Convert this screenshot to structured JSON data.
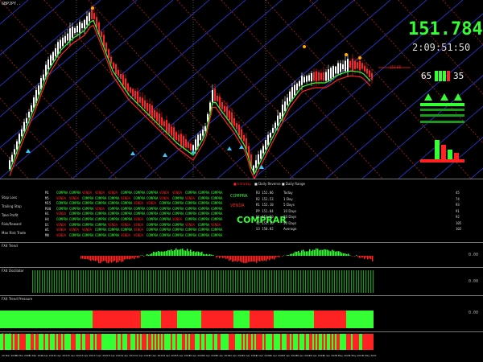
{
  "price": {
    "big": "151.784",
    "time": "2:09:51:50",
    "small_a": "65",
    "small_b": "35",
    "red_line_label": "151.66",
    "header": "GBPJPY.."
  },
  "tf_grid": {
    "row_labels": [
      "M1",
      "M5",
      "M15",
      "M30",
      "H1",
      "H4",
      "D1",
      "W1",
      "MN"
    ],
    "left_labels": [
      "Stop Loss",
      "Trailing Stop",
      "Take Profit",
      "Risk/Reward",
      "Max Risk Trade"
    ],
    "cell_text": "COMPRA",
    "cell_alt": "VENDA"
  },
  "signal": {
    "compra_label": "COMPRA",
    "compra_big": "COMPRAR",
    "venda_label": "VENDA",
    "intraday": "Intraday",
    "daily_reverse": "Daily Reverse",
    "daily_range": "Daily Range"
  },
  "levels": {
    "items": [
      {
        "code": "R3",
        "value": "152.86"
      },
      {
        "code": "R2",
        "value": "152.53"
      },
      {
        "code": "R1",
        "value": "152.18"
      },
      {
        "code": "PP",
        "value": "151.84"
      },
      {
        "code": "S1",
        "value": "151.50"
      },
      {
        "code": "S2",
        "value": "151.16"
      },
      {
        "code": "S3",
        "value": "150.82"
      }
    ]
  },
  "ranges": {
    "items": [
      {
        "label": "Today",
        "value": "45"
      },
      {
        "label": "1 Day",
        "value": "74"
      },
      {
        "label": "5 Days",
        "value": "93"
      },
      {
        "label": "10 Days",
        "value": "91"
      },
      {
        "label": "20 Days",
        "value": "92"
      },
      {
        "label": "50 Days",
        "value": "105"
      },
      {
        "label": "Average",
        "value": "102"
      }
    ]
  },
  "axis": {
    "x_labels": [
      "29 Mar 2021",
      "30 Mar 2021",
      "31 Mar 2021",
      "1 Apr 2021",
      "2 Apr 2021",
      "5 Apr 2021",
      "6 Apr 2021",
      "7 Apr 2021",
      "8 Apr 2021",
      "9 Apr 2021",
      "12 Apr 2021",
      "13 Apr 2021",
      "14 Apr 2021",
      "15 Apr 2021",
      "16 Apr 2021",
      "19 Apr 2021",
      "20 Apr 2021",
      "21 Apr 2021",
      "22 Apr 2021",
      "23 Apr 2021",
      "26 Apr 2021",
      "27 Apr 2021",
      "28 Apr 2021",
      "29 Apr 2021",
      "30 Apr 2021",
      "3 May 2021",
      "4 May 2021",
      "5 May 2021"
    ],
    "y_panel1": "0.00",
    "y_panel2": "0.00",
    "y_panel3": "0.00"
  },
  "panels": {
    "p1": "FX4 Trend",
    "p2": "FX4 Oscillator",
    "p3": "FX4 Trend Pressure",
    "p4": "FX4 Signal"
  },
  "colors": {
    "bull": "#33ff33",
    "bear": "#ff2222",
    "grid_line": "#3344ff",
    "bg": "#000000"
  }
}
